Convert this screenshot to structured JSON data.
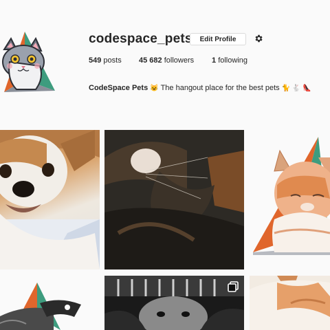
{
  "profile": {
    "username": "codespace_pets",
    "edit_label": "Edit Profile",
    "settings_icon": "gear-icon",
    "avatar_icon": "cat-mascot-avatar"
  },
  "stats": {
    "posts_count": "549",
    "posts_label": "posts",
    "followers_count": "45 682",
    "followers_label": "followers",
    "following_count": "1",
    "following_label": "following"
  },
  "bio": {
    "name": "CodeSpace Pets",
    "emoji_after_name": "😺",
    "text": "The hangout place for the best pets",
    "emoji_tail": "🐈 🐇 👠"
  },
  "posts": [
    {
      "subject": "puppy-photo",
      "multi": false
    },
    {
      "subject": "calico-cat-photo",
      "multi": false
    },
    {
      "subject": "orange-cat-sticker",
      "multi": false
    },
    {
      "subject": "dog-sticker",
      "multi": false
    },
    {
      "subject": "black-white-dog-photo",
      "multi": true
    },
    {
      "subject": "cat-photo",
      "multi": false
    }
  ],
  "colors": {
    "triangle_orange": "#e0662c",
    "triangle_teal": "#3e9c7e",
    "triangle_gray": "#8a8f99",
    "button_border": "#dbdbdb",
    "text": "#262626"
  }
}
